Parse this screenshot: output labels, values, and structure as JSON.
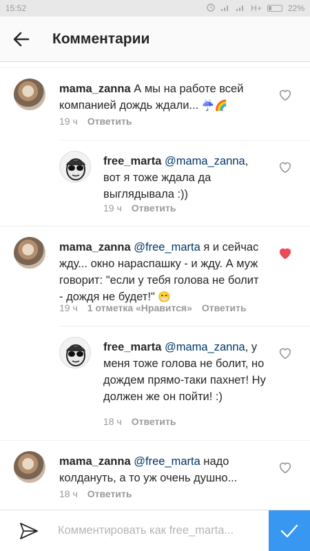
{
  "status_bar": {
    "time": "15:52",
    "network": "H+",
    "battery": "22%",
    "battery_level": 0.22
  },
  "header": {
    "title": "Комментарии"
  },
  "comments": [
    {
      "user": "mama_zanna",
      "mention": "",
      "text": " А мы на работе всей компанией дождь ждали... ",
      "emoji": "☔🌈",
      "time": "19 ч",
      "likes": "",
      "reply": "Ответить",
      "liked": false
    },
    {
      "user": "free_marta",
      "mention": "@mama_zanna",
      "text": ", вот я тоже ждала да выглядывала :))",
      "emoji": "",
      "time": "19 ч",
      "likes": "",
      "reply": "Ответить",
      "liked": false
    },
    {
      "user": "mama_zanna",
      "mention": "@free_marta",
      "text": " я и сейчас жду... окно нараспашку - и жду. А муж говорит: \"если у тебя голова не болит - дождя не будет!\" ",
      "emoji": "😁",
      "time": "19 ч",
      "likes": "1 отметка «Нравится»",
      "reply": "Ответить",
      "liked": true
    },
    {
      "user": "free_marta",
      "mention": "@mama_zanna",
      "text": ", у меня тоже голова не болит, но дождем прямо-таки пахнет! Ну должен же он пойти! :)",
      "emoji": "",
      "time": "18 ч",
      "likes": "",
      "reply": "Ответить",
      "liked": false
    },
    {
      "user": "mama_zanna",
      "mention": "@free_marta",
      "text": " надо колдануть, а то уж очень душно...",
      "emoji": "",
      "time": "18 ч",
      "likes": "",
      "reply": "Ответить",
      "liked": false
    }
  ],
  "composer": {
    "placeholder": "Комментировать как free_marta..."
  },
  "colors": {
    "accent": "#3897f0",
    "like_red": "#ed4956",
    "mention": "#003569",
    "meta": "#999999"
  }
}
